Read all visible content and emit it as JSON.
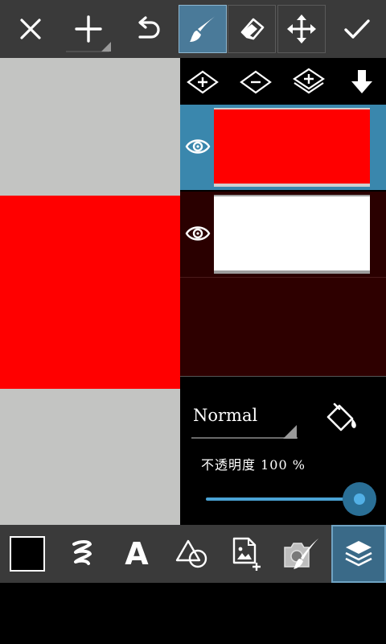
{
  "top_toolbar": {
    "buttons": [
      {
        "name": "close",
        "icon": "close-icon"
      },
      {
        "name": "add",
        "icon": "plus-icon"
      },
      {
        "name": "undo",
        "icon": "undo-icon"
      },
      {
        "name": "brush",
        "icon": "brush-icon",
        "active": true
      },
      {
        "name": "eraser",
        "icon": "eraser-icon"
      },
      {
        "name": "move",
        "icon": "move-icon"
      },
      {
        "name": "apply",
        "icon": "checkmark-icon"
      }
    ]
  },
  "canvas": {
    "background_color": "#c3c4c2",
    "shape_color": "#ff0000"
  },
  "layer_actions": [
    {
      "name": "add-layer",
      "icon": "add-layer-icon"
    },
    {
      "name": "remove-layer",
      "icon": "remove-layer-icon"
    },
    {
      "name": "duplicate-layer",
      "icon": "duplicate-layer-icon"
    },
    {
      "name": "merge-down",
      "icon": "arrow-down-icon"
    }
  ],
  "layers": [
    {
      "visible": true,
      "selected": true,
      "fill": "#ff0000"
    },
    {
      "visible": true,
      "selected": false,
      "fill": "#ffffff"
    }
  ],
  "blend": {
    "mode": "Normal",
    "opacity_label": "不透明度 100 %",
    "opacity_value": 100
  },
  "bottom_toolbar": {
    "text_tool_label": "A",
    "tools": [
      {
        "name": "color",
        "icon": "color-swatch-icon"
      },
      {
        "name": "brush-stroke",
        "icon": "stroke-icon"
      },
      {
        "name": "text",
        "icon": "text-icon"
      },
      {
        "name": "shapes",
        "icon": "shapes-icon"
      },
      {
        "name": "add-image",
        "icon": "add-image-icon"
      },
      {
        "name": "camera-brush",
        "icon": "camera-brush-icon"
      },
      {
        "name": "layers",
        "icon": "layers-icon",
        "active": true
      }
    ]
  },
  "colors": {
    "toolbar": "#3a3a3a",
    "accent": "#3a87ad",
    "slider": "#4aa3d5"
  }
}
